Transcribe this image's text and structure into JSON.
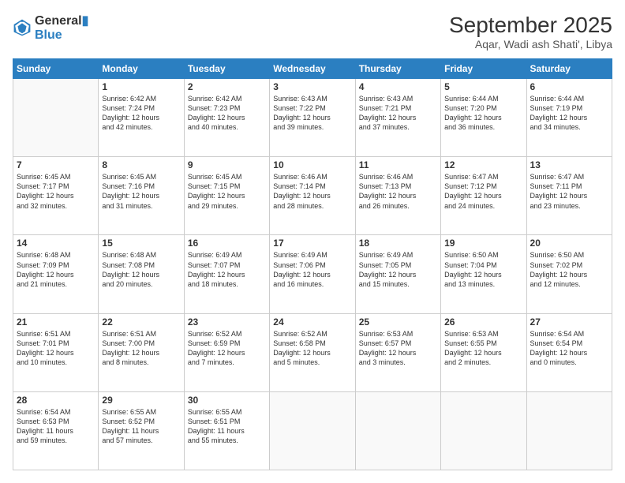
{
  "logo": {
    "line1": "General",
    "line2": "Blue"
  },
  "title": "September 2025",
  "location": "Aqar, Wadi ash Shati', Libya",
  "days_of_week": [
    "Sunday",
    "Monday",
    "Tuesday",
    "Wednesday",
    "Thursday",
    "Friday",
    "Saturday"
  ],
  "weeks": [
    [
      {
        "day": "",
        "info": ""
      },
      {
        "day": "1",
        "info": "Sunrise: 6:42 AM\nSunset: 7:24 PM\nDaylight: 12 hours\nand 42 minutes."
      },
      {
        "day": "2",
        "info": "Sunrise: 6:42 AM\nSunset: 7:23 PM\nDaylight: 12 hours\nand 40 minutes."
      },
      {
        "day": "3",
        "info": "Sunrise: 6:43 AM\nSunset: 7:22 PM\nDaylight: 12 hours\nand 39 minutes."
      },
      {
        "day": "4",
        "info": "Sunrise: 6:43 AM\nSunset: 7:21 PM\nDaylight: 12 hours\nand 37 minutes."
      },
      {
        "day": "5",
        "info": "Sunrise: 6:44 AM\nSunset: 7:20 PM\nDaylight: 12 hours\nand 36 minutes."
      },
      {
        "day": "6",
        "info": "Sunrise: 6:44 AM\nSunset: 7:19 PM\nDaylight: 12 hours\nand 34 minutes."
      }
    ],
    [
      {
        "day": "7",
        "info": "Sunrise: 6:45 AM\nSunset: 7:17 PM\nDaylight: 12 hours\nand 32 minutes."
      },
      {
        "day": "8",
        "info": "Sunrise: 6:45 AM\nSunset: 7:16 PM\nDaylight: 12 hours\nand 31 minutes."
      },
      {
        "day": "9",
        "info": "Sunrise: 6:45 AM\nSunset: 7:15 PM\nDaylight: 12 hours\nand 29 minutes."
      },
      {
        "day": "10",
        "info": "Sunrise: 6:46 AM\nSunset: 7:14 PM\nDaylight: 12 hours\nand 28 minutes."
      },
      {
        "day": "11",
        "info": "Sunrise: 6:46 AM\nSunset: 7:13 PM\nDaylight: 12 hours\nand 26 minutes."
      },
      {
        "day": "12",
        "info": "Sunrise: 6:47 AM\nSunset: 7:12 PM\nDaylight: 12 hours\nand 24 minutes."
      },
      {
        "day": "13",
        "info": "Sunrise: 6:47 AM\nSunset: 7:11 PM\nDaylight: 12 hours\nand 23 minutes."
      }
    ],
    [
      {
        "day": "14",
        "info": "Sunrise: 6:48 AM\nSunset: 7:09 PM\nDaylight: 12 hours\nand 21 minutes."
      },
      {
        "day": "15",
        "info": "Sunrise: 6:48 AM\nSunset: 7:08 PM\nDaylight: 12 hours\nand 20 minutes."
      },
      {
        "day": "16",
        "info": "Sunrise: 6:49 AM\nSunset: 7:07 PM\nDaylight: 12 hours\nand 18 minutes."
      },
      {
        "day": "17",
        "info": "Sunrise: 6:49 AM\nSunset: 7:06 PM\nDaylight: 12 hours\nand 16 minutes."
      },
      {
        "day": "18",
        "info": "Sunrise: 6:49 AM\nSunset: 7:05 PM\nDaylight: 12 hours\nand 15 minutes."
      },
      {
        "day": "19",
        "info": "Sunrise: 6:50 AM\nSunset: 7:04 PM\nDaylight: 12 hours\nand 13 minutes."
      },
      {
        "day": "20",
        "info": "Sunrise: 6:50 AM\nSunset: 7:02 PM\nDaylight: 12 hours\nand 12 minutes."
      }
    ],
    [
      {
        "day": "21",
        "info": "Sunrise: 6:51 AM\nSunset: 7:01 PM\nDaylight: 12 hours\nand 10 minutes."
      },
      {
        "day": "22",
        "info": "Sunrise: 6:51 AM\nSunset: 7:00 PM\nDaylight: 12 hours\nand 8 minutes."
      },
      {
        "day": "23",
        "info": "Sunrise: 6:52 AM\nSunset: 6:59 PM\nDaylight: 12 hours\nand 7 minutes."
      },
      {
        "day": "24",
        "info": "Sunrise: 6:52 AM\nSunset: 6:58 PM\nDaylight: 12 hours\nand 5 minutes."
      },
      {
        "day": "25",
        "info": "Sunrise: 6:53 AM\nSunset: 6:57 PM\nDaylight: 12 hours\nand 3 minutes."
      },
      {
        "day": "26",
        "info": "Sunrise: 6:53 AM\nSunset: 6:55 PM\nDaylight: 12 hours\nand 2 minutes."
      },
      {
        "day": "27",
        "info": "Sunrise: 6:54 AM\nSunset: 6:54 PM\nDaylight: 12 hours\nand 0 minutes."
      }
    ],
    [
      {
        "day": "28",
        "info": "Sunrise: 6:54 AM\nSunset: 6:53 PM\nDaylight: 11 hours\nand 59 minutes."
      },
      {
        "day": "29",
        "info": "Sunrise: 6:55 AM\nSunset: 6:52 PM\nDaylight: 11 hours\nand 57 minutes."
      },
      {
        "day": "30",
        "info": "Sunrise: 6:55 AM\nSunset: 6:51 PM\nDaylight: 11 hours\nand 55 minutes."
      },
      {
        "day": "",
        "info": ""
      },
      {
        "day": "",
        "info": ""
      },
      {
        "day": "",
        "info": ""
      },
      {
        "day": "",
        "info": ""
      }
    ]
  ]
}
